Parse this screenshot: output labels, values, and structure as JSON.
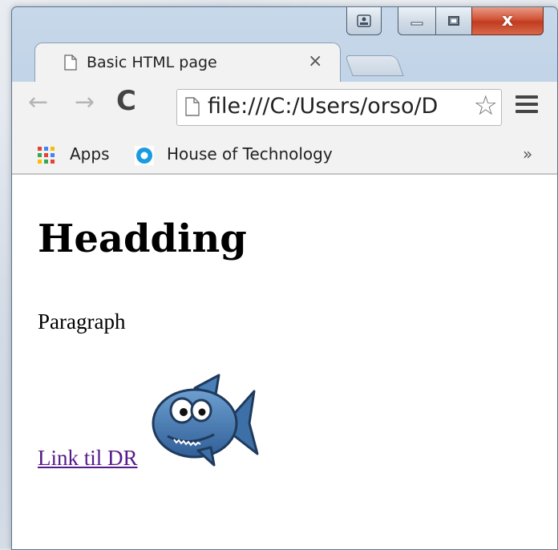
{
  "window": {
    "caption_buttons": [
      "user-icon",
      "minimize-icon",
      "maximize-icon",
      "close-icon"
    ],
    "close_glyph": "x"
  },
  "tab": {
    "title": "Basic HTML page",
    "close_glyph": "×"
  },
  "toolbar": {
    "back_glyph": "←",
    "forward_glyph": "→",
    "reload_glyph": "C",
    "url": "file:///C:/Users/orso/D",
    "star_glyph": "☆"
  },
  "bookmarks": {
    "apps_label": "Apps",
    "items": [
      {
        "label": "House of Technology"
      }
    ],
    "more_glyph": "»"
  },
  "page": {
    "heading": "Headding",
    "paragraph": "Paragraph",
    "link_text": "Link til DR",
    "image": "shark-fish-image"
  },
  "colors": {
    "link_visited": "#551a8b",
    "close_button": "#c13b20",
    "window_frame": "#b7cbe0"
  }
}
